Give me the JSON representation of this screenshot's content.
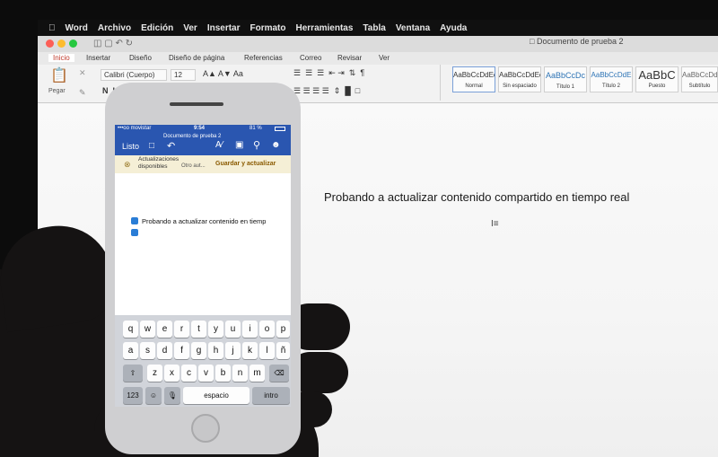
{
  "mac": {
    "menu": [
      "Word",
      "Archivo",
      "Edición",
      "Ver",
      "Insertar",
      "Formato",
      "Herramientas",
      "Tabla",
      "Ventana",
      "Ayuda"
    ],
    "doc_title": "Documento de prueba 2",
    "tabs": [
      "Inicio",
      "Insertar",
      "Diseño",
      "Diseño de página",
      "Referencias",
      "Correo",
      "Revisar",
      "Ver"
    ],
    "paste_label": "Pegar",
    "font_name": "Calibri (Cuerpo)",
    "font_size": "12",
    "styles": [
      {
        "preview": "AaBbCcDdEe",
        "name": "Normal"
      },
      {
        "preview": "AaBbCcDdEe",
        "name": "Sin espaciado"
      },
      {
        "preview": "AaBbCcDc",
        "name": "Título 1"
      },
      {
        "preview": "AaBbCcDdE",
        "name": "Título 2"
      },
      {
        "preview": "AaBbC",
        "name": "Puesto"
      },
      {
        "preview": "AaBbCcDdE",
        "name": "Subtítulo"
      }
    ],
    "body_text": "Probando a actualizar contenido compartido en tiempo real"
  },
  "phone": {
    "carrier": "•••oo movistar",
    "time": "9:54",
    "battery": "81 %",
    "doc_title": "Documento de prueba 2",
    "done_label": "Listo",
    "banner_title": "Actualizaciones disponibles",
    "banner_sub": "Otro aut...",
    "banner_action": "Guardar y actualizar",
    "body_text": "Probando a actualizar contenido en tiemp",
    "keyboard": {
      "row1": [
        "q",
        "w",
        "e",
        "r",
        "t",
        "y",
        "u",
        "i",
        "o",
        "p"
      ],
      "row2": [
        "a",
        "s",
        "d",
        "f",
        "g",
        "h",
        "j",
        "k",
        "l",
        "ñ"
      ],
      "row3": [
        "z",
        "x",
        "c",
        "v",
        "b",
        "n",
        "m"
      ],
      "numbers": "123",
      "space": "espacio",
      "return": "intro"
    }
  }
}
